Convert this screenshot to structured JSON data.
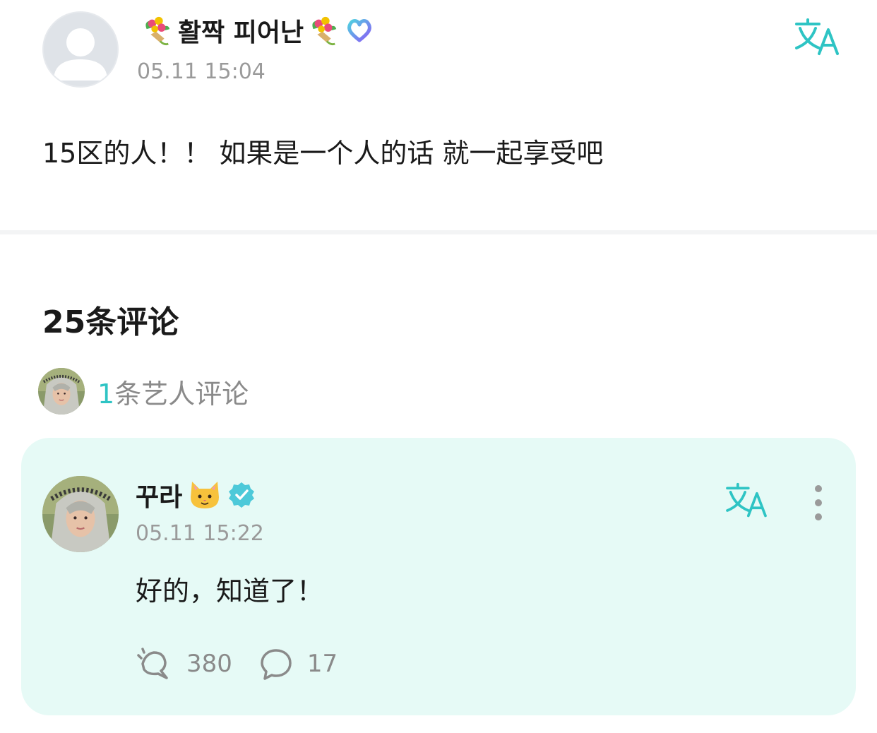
{
  "post": {
    "author_name": "활짝 피어난",
    "timestamp": "05.11 15:04",
    "body": "15区的人！！ 如果是一个人的话 就一起享受吧",
    "icons": {
      "avatar": "default-avatar-icon",
      "decor": "bouquet-icon",
      "badge": "heart-badge-icon",
      "translate": "translate-icon"
    }
  },
  "comments": {
    "title": "25条评论",
    "artist_summary": {
      "count": "1",
      "label": "条艺人评论"
    }
  },
  "comment": {
    "author_name": "꾸라",
    "timestamp": "05.11 15:22",
    "text": "好的，知道了！",
    "likes": "380",
    "replies": "17",
    "icons": {
      "emoji": "cat-face-icon",
      "badge": "verified-check-icon"
    }
  },
  "colors": {
    "accent": "#2ec4c4",
    "card_bg": "#e6faf6",
    "muted": "#9a9a9a",
    "text": "#1a1a1a"
  }
}
